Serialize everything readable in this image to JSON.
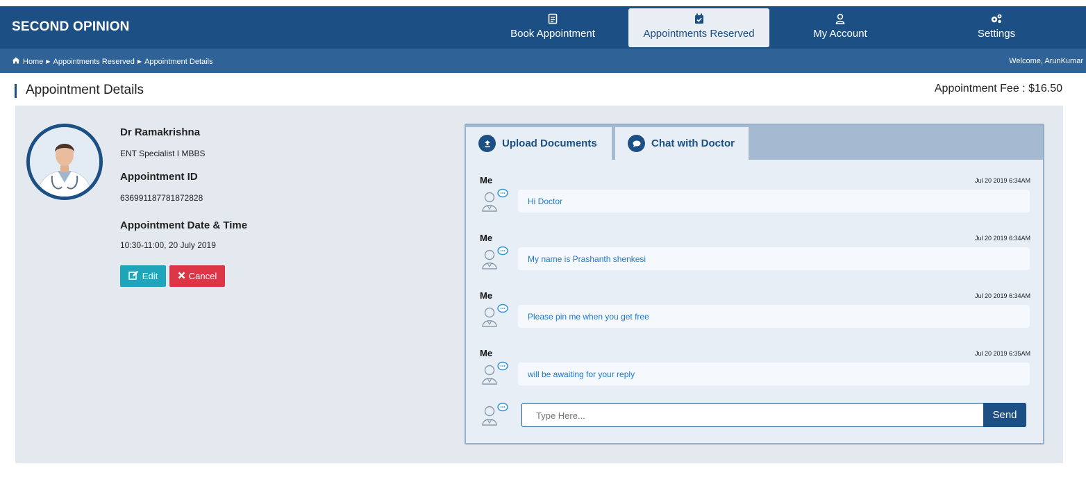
{
  "app": {
    "brand": "SECOND OPINION"
  },
  "nav": {
    "items": [
      {
        "label": "Book Appointment",
        "icon": "calendar-book-icon"
      },
      {
        "label": "Appointments Reserved",
        "icon": "calendar-check-icon",
        "active": true
      },
      {
        "label": "My Account",
        "icon": "user-icon"
      },
      {
        "label": "Settings",
        "icon": "gears-icon"
      }
    ]
  },
  "breadcrumb": {
    "items": [
      "Home",
      "Appointments Reserved",
      "Appointment Details"
    ],
    "welcome": "Welcome, ArunKumar"
  },
  "page": {
    "title": "Appointment Details",
    "fee": "Appointment Fee : $16.50"
  },
  "doctor": {
    "name": "Dr Ramakrishna",
    "specialty": "ENT Specialist I MBBS",
    "id_label": "Appointment ID",
    "id_value": "636991187781872828",
    "datetime_label": "Appointment Date & Time",
    "datetime_value": "10:30-11:00, 20 July 2019"
  },
  "actions": {
    "edit": "Edit",
    "cancel": "Cancel"
  },
  "tabs": {
    "upload": "Upload Documents",
    "chat": "Chat with Doctor"
  },
  "messages": [
    {
      "sender": "Me",
      "time": "Jul 20 2019 6:34AM",
      "text": "Hi Doctor"
    },
    {
      "sender": "Me",
      "time": "Jul 20 2019 6:34AM",
      "text": "My name is Prashanth shenkesi"
    },
    {
      "sender": "Me",
      "time": "Jul 20 2019 6:34AM",
      "text": "Please pin me when you get free"
    },
    {
      "sender": "Me",
      "time": "Jul 20 2019 6:35AM",
      "text": "will be awaiting for your reply"
    }
  ],
  "composer": {
    "placeholder": "Type Here...",
    "send": "Send"
  },
  "colors": {
    "primary": "#1c4f83",
    "secondary": "#2f6397",
    "edit": "#1ea5b9",
    "cancel": "#dc3545",
    "message_text": "#1c78d4"
  }
}
